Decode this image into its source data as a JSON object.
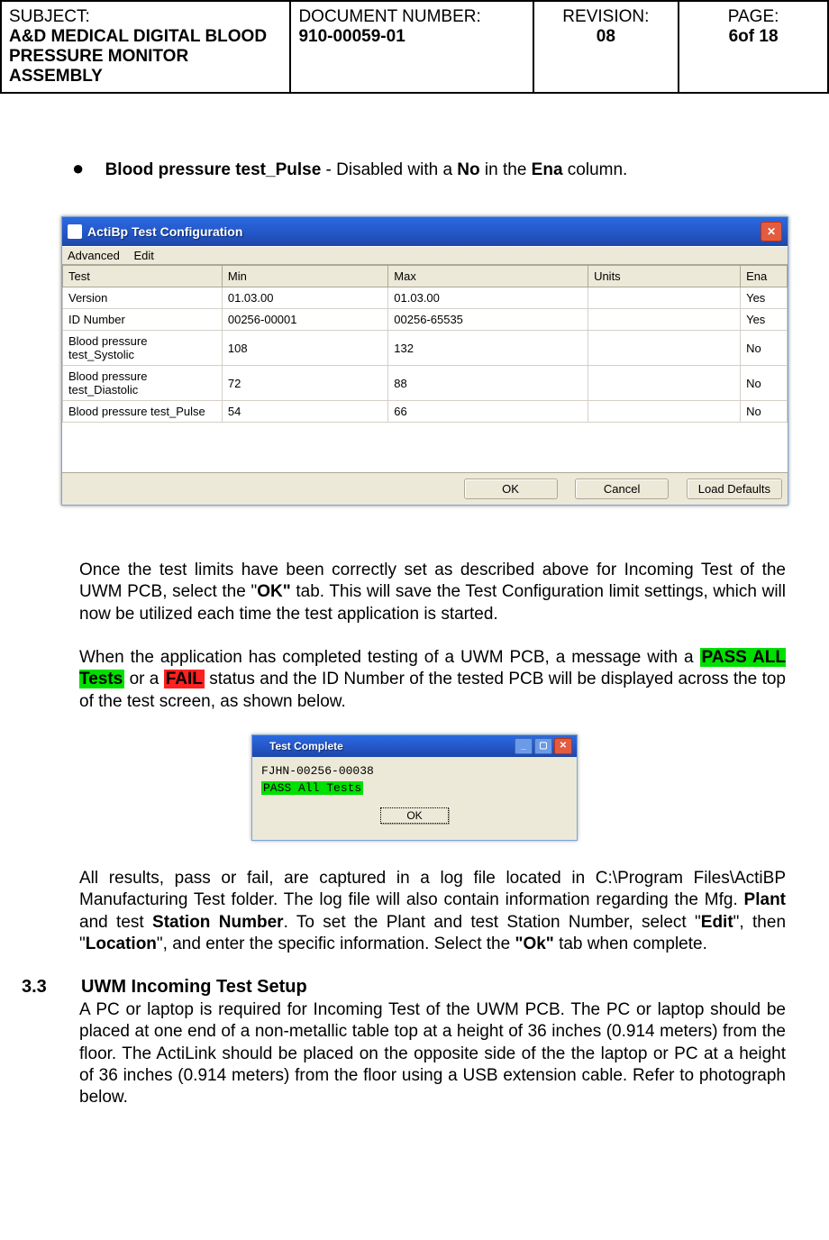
{
  "header": {
    "subject_label": "SUBJECT:",
    "subject_value": "A&D MEDICAL DIGITAL BLOOD PRESSURE MONITOR ASSEMBLY",
    "docnum_label": "DOCUMENT NUMBER:",
    "docnum_value": "910-00059-01",
    "rev_label": "REVISION:",
    "rev_value": "08",
    "page_label": "PAGE:",
    "page_value": "6of 18"
  },
  "bullet": {
    "b1": "Blood pressure test_Pulse",
    "mid": " - Disabled with a ",
    "no": "No",
    "mid2": " in the ",
    "ena": "Ena",
    "end": " column."
  },
  "dialog1": {
    "title": "ActiBp Test Configuration",
    "menu1": "Advanced",
    "menu2": "Edit",
    "cols": {
      "test": "Test",
      "min": "Min",
      "max": "Max",
      "units": "Units",
      "ena": "Ena"
    },
    "rows": [
      {
        "test": "Version",
        "min": "01.03.00",
        "max": "01.03.00",
        "units": "",
        "ena": "Yes"
      },
      {
        "test": "ID Number",
        "min": "00256-00001",
        "max": "00256-65535",
        "units": "",
        "ena": "Yes"
      },
      {
        "test": "Blood pressure test_Systolic",
        "min": "108",
        "max": "132",
        "units": "",
        "ena": "No"
      },
      {
        "test": "Blood pressure test_Diastolic",
        "min": "72",
        "max": "88",
        "units": "",
        "ena": "No"
      },
      {
        "test": "Blood pressure test_Pulse",
        "min": "54",
        "max": "66",
        "units": "",
        "ena": "No"
      }
    ],
    "btn_ok": "OK",
    "btn_cancel": "Cancel",
    "btn_defaults": "Load Defaults"
  },
  "para1_a": "Once the test limits have been correctly set as described above for Incoming Test of the UWM PCB, select the \"",
  "para1_ok": "OK\"",
  "para1_b": " tab. This will save the Test Configuration limit settings, which will now be utilized each time the test application is started.",
  "para2_a": "When the application has completed testing of a UWM PCB, a message with a ",
  "para2_pass": "PASS ALL Tests",
  "para2_or": "  or a ",
  "para2_fail": "FAIL",
  "para2_b": " status and the ID Number of the tested PCB will be displayed across the top of the test screen, as shown below.",
  "dialog2": {
    "title": "Test Complete",
    "line1": "FJHN-00256-00038",
    "line2": "PASS All Tests",
    "ok": "OK"
  },
  "para3_a": "All results, pass or fail, are captured in a log file located in C:\\Program Files\\ActiBP Manufacturing Test folder.  The log file will also contain information regarding the Mfg. ",
  "para3_plant": "Plant",
  "para3_b": " and test ",
  "para3_station": "Station Number",
  "para3_c": ".   To set the Plant  and test Station Number, select \"",
  "para3_edit": "Edit",
  "para3_d": "\", then \"",
  "para3_loc": "Location",
  "para3_e": "\", and    enter  the  specific  information.  Select  the  ",
  "para3_ok": "\"Ok\"",
  "para3_f": "  tab when complete.",
  "section": {
    "num": "3.3",
    "title": "UWM Incoming Test Setup",
    "body": "A PC or laptop is required for Incoming Test of the UWM PCB. The PC or laptop should be placed at one end of a non-metallic table top at a height of 36 inches (0.914 meters) from the floor. The ActiLink should be placed on the opposite side of  the   the laptop or PC at a height of 36 inches (0.914 meters) from the floor using a USB extension cable. Refer to photograph below."
  }
}
